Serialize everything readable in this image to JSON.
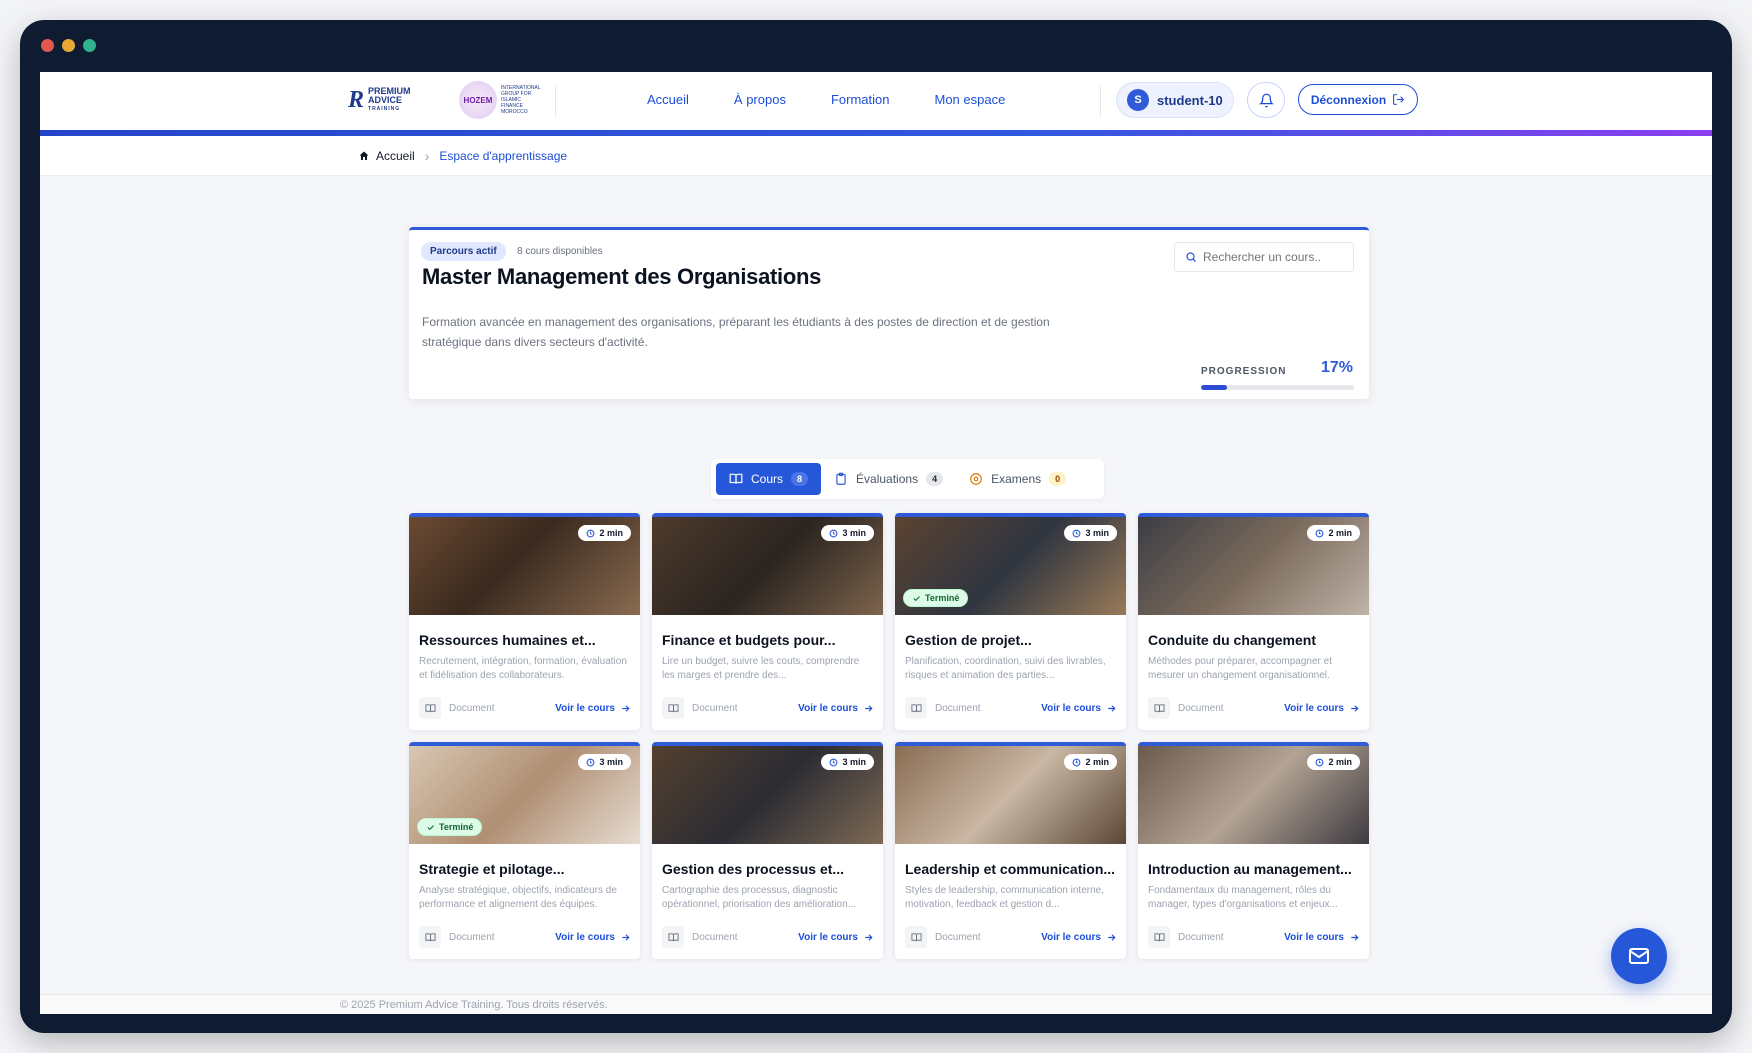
{
  "window": {
    "dots": [
      "#e2584e",
      "#e8a836",
      "#2fb38c"
    ]
  },
  "header": {
    "logo1": {
      "mark": "R",
      "line1": "PREMIUM",
      "line2": "ADVICE",
      "line3": "TRAINING"
    },
    "logo2": {
      "mark": "HOZEM",
      "text": "INTERNATIONAL GROUP FOR ISLAMIC FINANCE MOROCCO"
    },
    "nav": [
      "Accueil",
      "À propos",
      "Formation",
      "Mon espace"
    ],
    "user": {
      "initial": "S",
      "name": "student-10"
    },
    "logout_label": "Déconnexion"
  },
  "breadcrumb": {
    "home": "Accueil",
    "current": "Espace d'apprentissage"
  },
  "hero": {
    "badge": "Parcours actif",
    "available": "8 cours disponibles",
    "title": "Master Management des Organisations",
    "description": "Formation avancée en management des organisations, préparant les étudiants à des postes de direction et de gestion stratégique dans divers secteurs d'activité.",
    "search_placeholder": "Rechercher un cours..",
    "progress_label": "PROGRESSION",
    "progress_value": "17%",
    "progress_fraction": 0.17
  },
  "tabs": [
    {
      "label": "Cours",
      "count": "8",
      "active": true
    },
    {
      "label": "Évaluations",
      "count": "4",
      "active": false
    },
    {
      "label": "Examens",
      "count": "0",
      "active": false
    }
  ],
  "courses": [
    {
      "duration": "2 min",
      "title": "Ressources humaines et...",
      "desc": "Recrutement, intégration, formation, évaluation et fidélisation des collaborateurs.",
      "type": "Document",
      "link": "Voir le cours",
      "done": ""
    },
    {
      "duration": "3 min",
      "title": "Finance et budgets pour...",
      "desc": "Lire un budget, suivre les couts, comprendre les marges et prendre des...",
      "type": "Document",
      "link": "Voir le cours",
      "done": ""
    },
    {
      "duration": "3 min",
      "title": "Gestion de projet...",
      "desc": "Planification, coordination, suivi des livrables, risques et animation des parties...",
      "type": "Document",
      "link": "Voir le cours",
      "done": "Terminé"
    },
    {
      "duration": "2 min",
      "title": "Conduite du changement",
      "desc": "Méthodes pour préparer, accompagner et mesurer un changement organisationnel.",
      "type": "Document",
      "link": "Voir le cours",
      "done": ""
    },
    {
      "duration": "3 min",
      "title": "Strategie et pilotage...",
      "desc": "Analyse stratégique, objectifs, indicateurs de performance et alignement des équipes.",
      "type": "Document",
      "link": "Voir le cours",
      "done": "Terminé"
    },
    {
      "duration": "3 min",
      "title": "Gestion des processus et...",
      "desc": "Cartographie des processus, diagnostic opérationnel, priorisation des amélioration...",
      "type": "Document",
      "link": "Voir le cours",
      "done": ""
    },
    {
      "duration": "2 min",
      "title": "Leadership et communication...",
      "desc": "Styles de leadership, communication interne, motivation, feedback et gestion d...",
      "type": "Document",
      "link": "Voir le cours",
      "done": ""
    },
    {
      "duration": "2 min",
      "title": "Introduction au management...",
      "desc": "Fondamentaux du management, rôles du manager, types d'organisations et enjeux...",
      "type": "Document",
      "link": "Voir le cours",
      "done": ""
    }
  ],
  "footer": {
    "copyright": "© 2025 Premium Advice Training. Tous droits réservés."
  }
}
